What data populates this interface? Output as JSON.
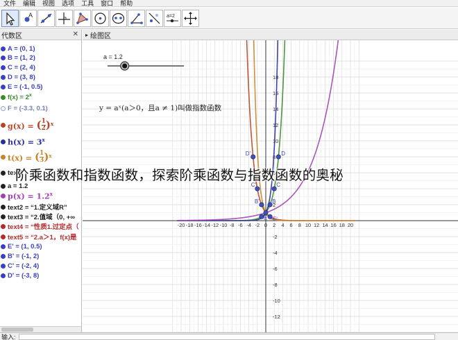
{
  "menu": [
    "文件",
    "编辑",
    "视图",
    "选项",
    "工具",
    "窗口",
    "帮助"
  ],
  "toolbar": {
    "tools": [
      {
        "name": "move-tool-icon",
        "active": true
      },
      {
        "name": "point-tool-icon"
      },
      {
        "name": "line-tool-icon"
      },
      {
        "name": "perpendicular-tool-icon"
      },
      {
        "name": "polygon-tool-icon"
      },
      {
        "name": "circle-tool-icon"
      },
      {
        "name": "ellipse-tool-icon"
      },
      {
        "name": "angle-tool-icon"
      },
      {
        "name": "reflect-tool-icon"
      },
      {
        "name": "slider-tool-icon",
        "label": "a=2"
      },
      {
        "name": "move-view-tool-icon"
      }
    ]
  },
  "algebra": {
    "title": "代数区",
    "items": [
      {
        "text": "A = (0, 1)",
        "color": "#3a3fbf"
      },
      {
        "text": "B = (1, 2)",
        "color": "#3a3fbf"
      },
      {
        "text": "C = (2, 4)",
        "color": "#3a3fbf"
      },
      {
        "text": "D = (3, 8)",
        "color": "#3a3fbf"
      },
      {
        "text": "E = (-1, 0.5)",
        "color": "#3a3fbf"
      },
      {
        "text": "f(x) = 2",
        "sup": "x",
        "color": "#3d8a2e"
      },
      {
        "text": "F = (-3.3, 0.1)",
        "color": "#7a7fb4",
        "hollow": true
      },
      {
        "lhs": "g(x) = ",
        "num": "1",
        "den": "2",
        "sup": "x",
        "color": "#b74425"
      },
      {
        "lhs": "h(x) = 3",
        "sup": "x",
        "color": "#2b2f9a"
      },
      {
        "lhs": "t(x) = ",
        "num": "1",
        "den": "3",
        "sup": "x",
        "color": "#c9842a"
      },
      {
        "text": "text1",
        "color": "#222"
      },
      {
        "text": "a = 1.2",
        "color": "#222"
      },
      {
        "lhs": "p(x) = 1.2",
        "sup": "x",
        "color": "#a340b5"
      },
      {
        "text": "text2 = “1.定义域R”",
        "color": "#222"
      },
      {
        "text": "text3 = “2.值域（0, +∞",
        "color": "#222"
      },
      {
        "text": "text4 = “性质1.过定点（",
        "color": "#b52b2b"
      },
      {
        "text": "text5 = “2.a＞1，f(x)是",
        "color": "#b52b2b"
      },
      {
        "text": "E' = (1, 0.5)",
        "color": "#3a3fbf"
      },
      {
        "text": "B' = (-1, 2)",
        "color": "#3a3fbf"
      },
      {
        "text": "C' = (-2, 4)",
        "color": "#3a3fbf"
      },
      {
        "text": "D' = (-3, 8)",
        "color": "#3a3fbf"
      }
    ]
  },
  "graphics": {
    "title": "绘图区",
    "slider": {
      "label": "a = 1.2",
      "value": 1.2,
      "min": 0.1,
      "max": 5
    },
    "definition_text": "y = aˣ(a＞0，且a ≠ 1)叫做指数函数",
    "x_ticks": [
      "-20",
      "-18",
      "-16",
      "-14",
      "-12",
      "-10",
      "-8",
      "-6",
      "-4",
      "-2",
      "0",
      "2",
      "4",
      "6",
      "8",
      "10",
      "12",
      "14",
      "16",
      "18",
      "20"
    ],
    "y_ticks": [
      "18",
      "16",
      "14",
      "12",
      "10",
      "8",
      "6",
      "4",
      "2",
      "-2",
      "-4",
      "-6",
      "-8",
      "-10",
      "-12"
    ],
    "point_labels": [
      "D'",
      "D",
      "C'",
      "C",
      "B'",
      "B",
      "E",
      "E'"
    ]
  },
  "chart_data": {
    "type": "line",
    "xlim": [
      -21,
      21
    ],
    "ylim": [
      -13,
      20
    ],
    "grid": true,
    "functions": [
      {
        "expr": "2^x",
        "base": 2,
        "color": "#3d8a2e"
      },
      {
        "expr": "(1/2)^x",
        "base": 0.5,
        "color": "#b74425"
      },
      {
        "expr": "3^x",
        "base": 3,
        "color": "#2b2f9a"
      },
      {
        "expr": "(1/3)^x",
        "base": 0.3333333,
        "color": "#c9842a"
      },
      {
        "expr": "1.2^x",
        "base": 1.2,
        "color": "#a340b5"
      }
    ],
    "points": [
      {
        "name": "A",
        "x": 0,
        "y": 1
      },
      {
        "name": "B",
        "x": 1,
        "y": 2
      },
      {
        "name": "C",
        "x": 2,
        "y": 4
      },
      {
        "name": "D",
        "x": 3,
        "y": 8
      },
      {
        "name": "E",
        "x": -1,
        "y": 0.5
      },
      {
        "name": "E'",
        "x": 1,
        "y": 0.5
      },
      {
        "name": "B'",
        "x": -1,
        "y": 2
      },
      {
        "name": "C'",
        "x": -2,
        "y": 4
      },
      {
        "name": "D'",
        "x": -3,
        "y": 8
      }
    ]
  },
  "input_bar": {
    "label": "输入:"
  },
  "overlay_caption": "阶乘函数和指数函数，探索阶乘函数与指数函数的奥秘"
}
